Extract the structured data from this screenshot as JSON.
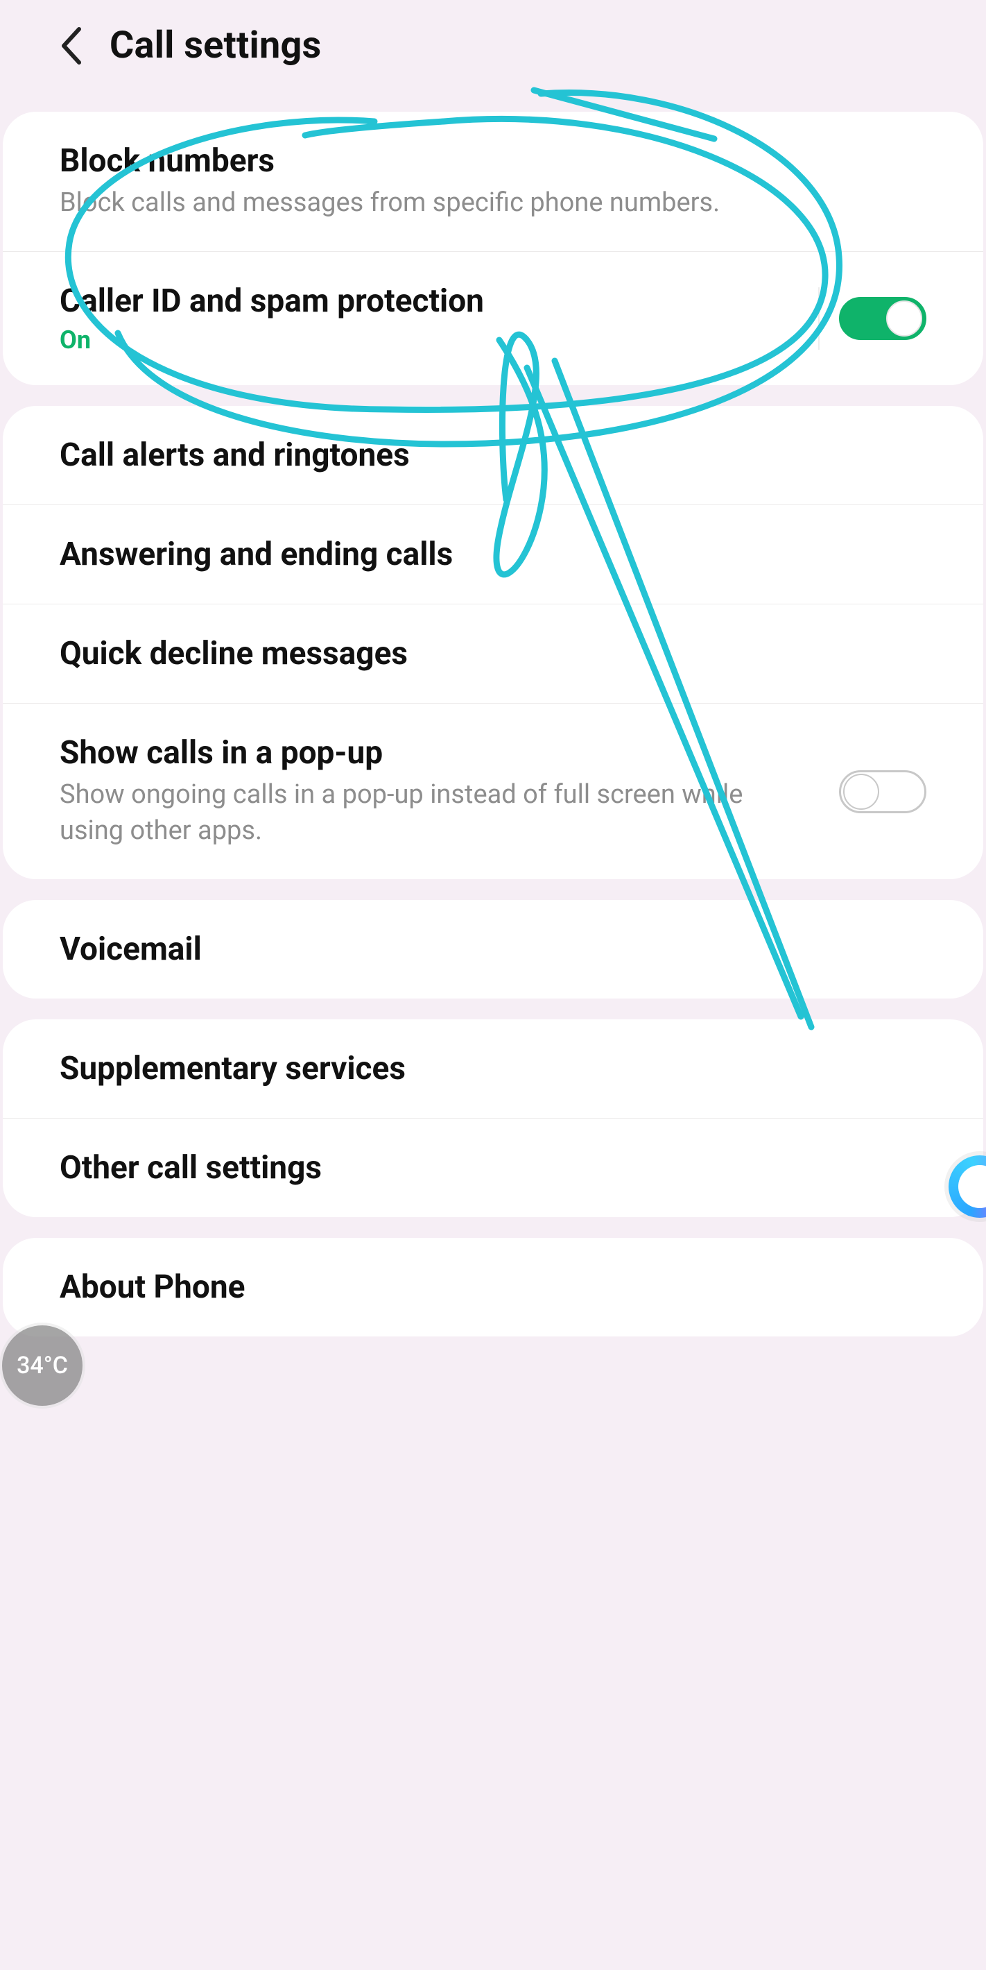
{
  "header": {
    "title": "Call settings"
  },
  "group1": {
    "block_numbers": {
      "title": "Block numbers",
      "subtitle": "Block calls and messages from specific phone numbers."
    },
    "caller_id": {
      "title": "Caller ID and spam protection",
      "status": "On",
      "toggle_on": true
    }
  },
  "group2": {
    "call_alerts": {
      "title": "Call alerts and ringtones"
    },
    "answering": {
      "title": "Answering and ending calls"
    },
    "quick_decline": {
      "title": "Quick decline messages"
    },
    "popup": {
      "title": "Show calls in a pop-up",
      "subtitle": "Show ongoing calls in a pop-up instead of full screen while using other apps.",
      "toggle_on": false
    }
  },
  "group3": {
    "voicemail": {
      "title": "Voicemail"
    }
  },
  "group4": {
    "supplementary": {
      "title": "Supplementary services"
    },
    "other": {
      "title": "Other call settings"
    }
  },
  "group5": {
    "about": {
      "title": "About Phone"
    }
  },
  "overlay": {
    "temperature": "34°C",
    "annotation_color": "#24c3d4"
  }
}
